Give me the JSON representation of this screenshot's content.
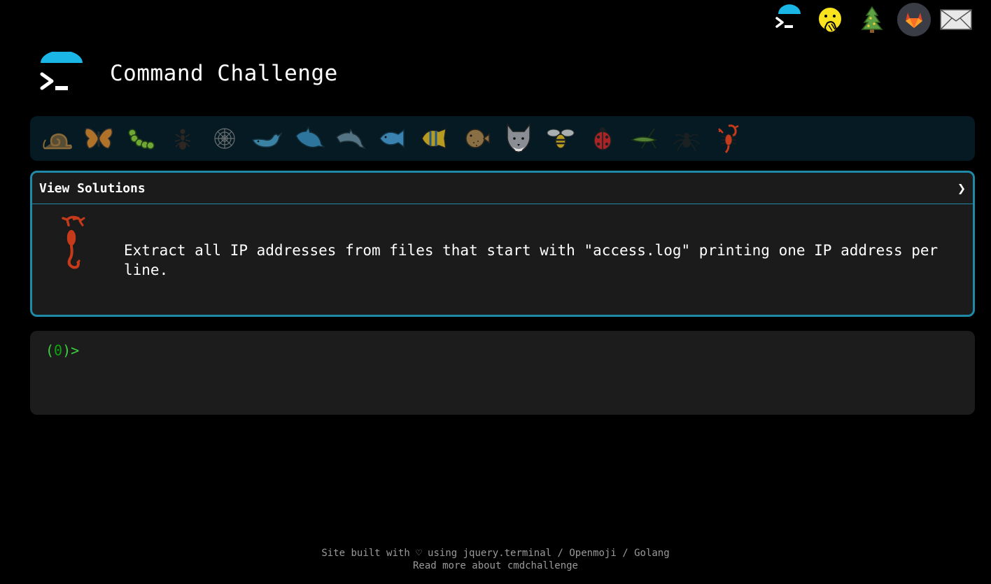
{
  "header": {
    "title": "Command Challenge",
    "icons": [
      "cmdchallenge-logo-icon",
      "face-with-hand-over-mouth-icon",
      "christmas-tree-icon",
      "gitlab-icon",
      "envelope-icon"
    ]
  },
  "challenges_strip": {
    "animals": [
      "snail-icon",
      "butterfly-icon",
      "caterpillar-icon",
      "ant-icon",
      "spider-web-icon",
      "whale-icon",
      "orca-icon",
      "dolphin-icon",
      "fish-icon",
      "tropical-fish-icon",
      "blowfish-icon",
      "wolf-icon",
      "bee-icon",
      "ladybug-icon",
      "cricket-icon",
      "spider-icon",
      "scorpion-icon"
    ],
    "current": "scorpion-icon"
  },
  "panel": {
    "header_label": "View Solutions",
    "chevron": "❯",
    "challenge_icon": "scorpion-icon",
    "description": "Extract all IP addresses from files that start with \"access.log\" printing one IP address per line."
  },
  "terminal": {
    "prompt_open": "(",
    "prompt_digit": "0",
    "prompt_close": ")>"
  },
  "footer": {
    "line1_prefix": "Site built with ♡ using ",
    "link_jquery": "jquery.terminal",
    "sep1": " / ",
    "link_openmoji": "Openmoji",
    "sep2": " / ",
    "link_golang": "Golang",
    "line2": "Read more about cmdchallenge"
  },
  "colors": {
    "accent": "#1f8aa8",
    "logo_cap": "#19b6e6",
    "prompt_green": "#3ed13e"
  }
}
